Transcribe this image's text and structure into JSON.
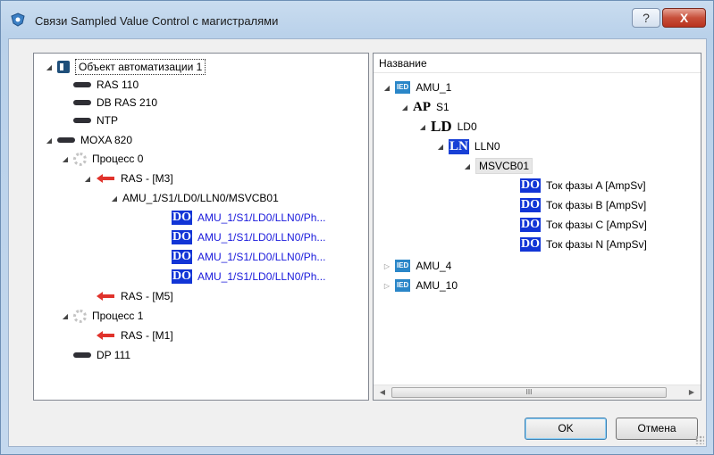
{
  "window": {
    "title": "Связи Sampled Value Control с магистралями",
    "help_label": "?",
    "close_label": "X"
  },
  "left_tree": [
    {
      "label": "Объект автоматизации 1",
      "icon": "automation-object-icon",
      "exp": "open"
    },
    {
      "label": "RAS 110",
      "icon": "device-icon",
      "exp": ""
    },
    {
      "label": "DB RAS 210",
      "icon": "device-icon",
      "exp": ""
    },
    {
      "label": "NTP",
      "icon": "device-icon",
      "exp": ""
    },
    {
      "label": "MOXA 820",
      "icon": "device-icon",
      "exp": "open"
    },
    {
      "label": "Процесс 0",
      "icon": "process-icon",
      "exp": "open"
    },
    {
      "label": "RAS - [M3]",
      "icon": "red-arrow-icon",
      "exp": "open"
    },
    {
      "label": "AMU_1/S1/LD0/LLN0/MSVCB01",
      "icon": "",
      "exp": "open"
    },
    {
      "label": "AMU_1/S1/LD0/LLN0/Ph...",
      "icon": "do-icon",
      "exp": ""
    },
    {
      "label": "AMU_1/S1/LD0/LLN0/Ph...",
      "icon": "do-icon",
      "exp": ""
    },
    {
      "label": "AMU_1/S1/LD0/LLN0/Ph...",
      "icon": "do-icon",
      "exp": ""
    },
    {
      "label": "AMU_1/S1/LD0/LLN0/Ph...",
      "icon": "do-icon",
      "exp": ""
    },
    {
      "label": "RAS - [M5]",
      "icon": "red-arrow-icon",
      "exp": ""
    },
    {
      "label": "Процесс 1",
      "icon": "process-icon",
      "exp": "open"
    },
    {
      "label": "RAS - [M1]",
      "icon": "red-arrow-icon",
      "exp": ""
    },
    {
      "label": "DP 111",
      "icon": "device-icon",
      "exp": ""
    }
  ],
  "right_panel": {
    "header": "Название",
    "tree": [
      {
        "label": "AMU_1",
        "icon": "ied-icon",
        "icon_text": "IED",
        "exp": "open"
      },
      {
        "label": "S1",
        "icon": "ap-icon",
        "icon_text": "AP",
        "exp": "open"
      },
      {
        "label": "LD0",
        "icon": "ld-icon",
        "icon_text": "LD",
        "exp": "open"
      },
      {
        "label": "LLN0",
        "icon": "ln-icon",
        "icon_text": "LN",
        "exp": "open"
      },
      {
        "label": "MSVCB01",
        "icon": "",
        "icon_text": "",
        "exp": "open"
      },
      {
        "label": "Ток фазы A [AmpSv]",
        "icon": "do-icon",
        "icon_text": "DO",
        "exp": ""
      },
      {
        "label": "Ток фазы B [AmpSv]",
        "icon": "do-icon",
        "icon_text": "DO",
        "exp": ""
      },
      {
        "label": "Ток фазы C [AmpSv]",
        "icon": "do-icon",
        "icon_text": "DO",
        "exp": ""
      },
      {
        "label": "Ток фазы N [AmpSv]",
        "icon": "do-icon",
        "icon_text": "DO",
        "exp": ""
      },
      {
        "label": "AMU_4",
        "icon": "ied-icon",
        "icon_text": "IED",
        "exp": "closed"
      },
      {
        "label": "AMU_10",
        "icon": "ied-icon",
        "icon_text": "IED",
        "exp": "closed"
      }
    ],
    "scroll_thumb": "III"
  },
  "buttons": {
    "ok": "OK",
    "cancel": "Отмена"
  },
  "do_icon_text": "DO"
}
